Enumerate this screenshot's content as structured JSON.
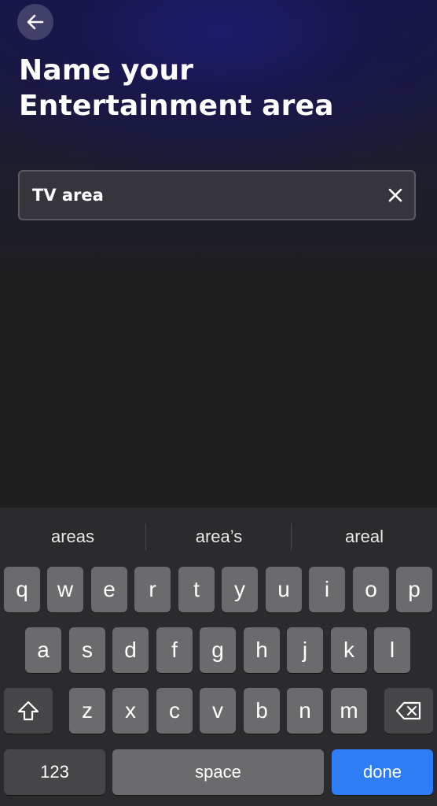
{
  "header": {
    "title_line1": "Name your",
    "title_line2": "Entertainment area"
  },
  "form": {
    "name_value": "TV area"
  },
  "keyboard": {
    "suggestions": [
      "areas",
      "area’s",
      "areal"
    ],
    "row1": [
      "q",
      "w",
      "e",
      "r",
      "t",
      "y",
      "u",
      "i",
      "o",
      "p"
    ],
    "row2": [
      "a",
      "s",
      "d",
      "f",
      "g",
      "h",
      "j",
      "k",
      "l"
    ],
    "row3": [
      "z",
      "x",
      "c",
      "v",
      "b",
      "n",
      "m"
    ],
    "numbers_label": "123",
    "space_label": "space",
    "done_label": "done"
  },
  "colors": {
    "accent": "#2f7df6",
    "background": "#1f1f20",
    "header_glow": "#1e1c6e",
    "field_background": "#35353b",
    "key": "#6b6b6e",
    "key_dark": "#464649"
  },
  "icons": {
    "back": "arrow-left-icon",
    "clear": "close-icon",
    "shift": "shift-icon",
    "delete": "backspace-icon"
  }
}
